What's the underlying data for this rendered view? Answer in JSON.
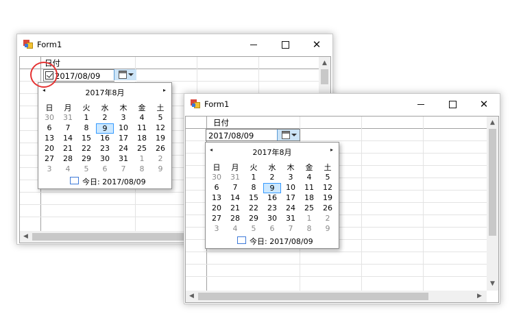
{
  "window": {
    "title": "Form1",
    "column_header": "日付",
    "date_value": "2017/08/09",
    "minimize_glyph": "minimize",
    "maximize_glyph": "maximize",
    "close_glyph": "✕"
  },
  "calendar": {
    "month_title": "2017年8月",
    "prev_icon": "◂",
    "next_icon": "▸",
    "weekdays": [
      "日",
      "月",
      "火",
      "水",
      "木",
      "金",
      "土"
    ],
    "weeks": [
      [
        "30",
        "31",
        "1",
        "2",
        "3",
        "4",
        "5"
      ],
      [
        "6",
        "7",
        "8",
        "9",
        "10",
        "11",
        "12"
      ],
      [
        "13",
        "14",
        "15",
        "16",
        "17",
        "18",
        "19"
      ],
      [
        "20",
        "21",
        "22",
        "23",
        "24",
        "25",
        "26"
      ],
      [
        "27",
        "28",
        "29",
        "30",
        "31",
        "1",
        "2"
      ],
      [
        "3",
        "4",
        "5",
        "6",
        "7",
        "8",
        "9"
      ]
    ],
    "other_month": [
      [
        true,
        true,
        false,
        false,
        false,
        false,
        false
      ],
      [
        false,
        false,
        false,
        false,
        false,
        false,
        false
      ],
      [
        false,
        false,
        false,
        false,
        false,
        false,
        false
      ],
      [
        false,
        false,
        false,
        false,
        false,
        false,
        false
      ],
      [
        false,
        false,
        false,
        false,
        false,
        true,
        true
      ],
      [
        true,
        true,
        true,
        true,
        true,
        true,
        true
      ]
    ],
    "selected_day": "9",
    "today_label": "今日: 2017/08/09"
  },
  "scroll_arrows": {
    "up": "▲",
    "down": "▼",
    "left": "◀",
    "right": "▶"
  },
  "colors": {
    "highlight_ring": "#e53131",
    "selection": "#cce8ff",
    "dropdown_button": "#cce4f7"
  }
}
